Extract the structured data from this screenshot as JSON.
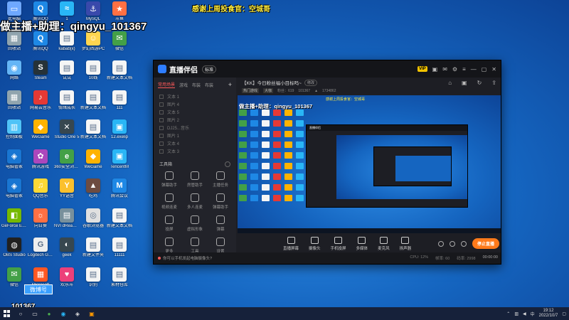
{
  "overlays": {
    "streamer_caption": "做主播+助理：qingyu_101367",
    "thanks_caption": "感谢上周投食官：空城哥",
    "tile_label": "微博号",
    "id_label": "101367"
  },
  "desktop_icons": [
    {
      "label": "此电脑",
      "color": "#6ea8ff",
      "glyph": "▭"
    },
    {
      "label": "腾讯QQ",
      "color": "#1e88e5",
      "glyph": "Q"
    },
    {
      "label": "1",
      "color": "#29b6f6",
      "glyph": "≈"
    },
    {
      "label": "MySQL",
      "color": "#3949ab",
      "glyph": "⚓"
    },
    {
      "label": "斗鱼",
      "color": "#ff7043",
      "glyph": "★"
    },
    {
      "label": "回收站",
      "color": "#90a4ae",
      "glyph": "▦"
    },
    {
      "label": "腾讯QQ",
      "color": "#1e88e5",
      "glyph": "Q"
    },
    {
      "label": "kabab(x)",
      "color": "#f5f5f5",
      "glyph": "▤"
    },
    {
      "label": "梦幻西游PC",
      "color": "#ffd54f",
      "glyph": "☺"
    },
    {
      "label": "微信",
      "color": "#43a047",
      "glyph": "✉"
    },
    {
      "label": "网络",
      "color": "#64b5f6",
      "glyph": "◉"
    },
    {
      "label": "Steam",
      "color": "#263238",
      "glyph": "S"
    },
    {
      "label": "试试",
      "color": "#f5f5f5",
      "glyph": "▤"
    },
    {
      "label": "10线",
      "color": "#f5f5f5",
      "glyph": "▤"
    },
    {
      "label": "新建文本文档",
      "color": "#f5f5f5",
      "glyph": "▤"
    },
    {
      "label": "回收站",
      "color": "#90a4ae",
      "glyph": "▦"
    },
    {
      "label": "网易云音乐",
      "color": "#e53935",
      "glyph": "♪"
    },
    {
      "label": "情绪成长",
      "color": "#f5f5f5",
      "glyph": "▤"
    },
    {
      "label": "新建文本文档",
      "color": "#f5f5f5",
      "glyph": "▤"
    },
    {
      "label": "111",
      "color": "#f5f5f5",
      "glyph": "▤"
    },
    {
      "label": "控制面板",
      "color": "#4fc3f7",
      "glyph": "▥"
    },
    {
      "label": "WeGame",
      "color": "#ffb300",
      "glyph": "◆"
    },
    {
      "label": "Studio One 5",
      "color": "#37474f",
      "glyph": "✕"
    },
    {
      "label": "新建文本文档",
      "color": "#f5f5f5",
      "glyph": "▤"
    },
    {
      "label": "12.exelip",
      "color": "#29b6f6",
      "glyph": "▣"
    },
    {
      "label": "电脑管家",
      "color": "#1976d2",
      "glyph": "◈"
    },
    {
      "label": "腾讯游戏",
      "color": "#ab47bc",
      "glyph": "✿"
    },
    {
      "label": "360安全浏览器",
      "color": "#43a047",
      "glyph": "e"
    },
    {
      "label": "WeGame",
      "color": "#ffb300",
      "glyph": "◆"
    },
    {
      "label": "TencentM",
      "color": "#29b6f6",
      "glyph": "▣"
    },
    {
      "label": "电脑管家",
      "color": "#1976d2",
      "glyph": "◈"
    },
    {
      "label": "QQ音乐",
      "color": "#fdd835",
      "glyph": "♫"
    },
    {
      "label": "YY语音",
      "color": "#fbc02d",
      "glyph": "Y"
    },
    {
      "label": "吃鸡",
      "color": "#6d4c41",
      "glyph": "▲"
    },
    {
      "label": "腾讯会议",
      "color": "#1e88e5",
      "glyph": "M"
    },
    {
      "label": "GeForce Experience",
      "color": "#76b900",
      "glyph": "◧"
    },
    {
      "label": "向日葵",
      "color": "#ff7043",
      "glyph": "☼"
    },
    {
      "label": "NVI dReamer",
      "color": "#78909c",
      "glyph": "▤"
    },
    {
      "label": "谷歌浏览器",
      "color": "#e0e0e0",
      "glyph": "◎"
    },
    {
      "label": "新建文本文档",
      "color": "#f5f5f5",
      "glyph": "▤"
    },
    {
      "label": "OBS Studio",
      "color": "#212121",
      "glyph": "◍"
    },
    {
      "label": "Logitech G HUB",
      "color": "#eeeeee",
      "glyph": "G"
    },
    {
      "label": "geek",
      "color": "#37474f",
      "glyph": "◐"
    },
    {
      "label": "新建文件夹",
      "color": "#f5f5f5",
      "glyph": "▤"
    },
    {
      "label": "11111",
      "color": "#f5f5f5",
      "glyph": "▤"
    },
    {
      "label": "微信",
      "color": "#43a047",
      "glyph": "✉"
    },
    {
      "label": "Microsoft",
      "color": "#ff5722",
      "glyph": "▦"
    },
    {
      "label": "欢乐斗",
      "color": "#ec407a",
      "glyph": "♥"
    },
    {
      "label": "识别",
      "color": "#f5f5f5",
      "glyph": "▤"
    },
    {
      "label": "素材仓库",
      "color": "#f5f5f5",
      "glyph": "▤"
    }
  ],
  "app": {
    "name": "直播伴侣",
    "version": "标准",
    "vip": "VIP",
    "tabs": [
      "常用场景",
      "游戏",
      "布装",
      "布装"
    ],
    "scenes": [
      "文本 1",
      "图片 4",
      "文本 5",
      "图片 2",
      "DJ25...音乐",
      "图片 1",
      "文本 4",
      "文本 3"
    ],
    "toolbox_label": "工具箱",
    "tools": [
      {
        "label": "弹幕助手"
      },
      {
        "label": "房管助手"
      },
      {
        "label": "主播任务"
      },
      {
        "label": "视频连麦"
      },
      {
        "label": "多人连麦"
      },
      {
        "label": "弹幕助手"
      },
      {
        "label": "投屏"
      },
      {
        "label": "虚拟形象"
      },
      {
        "label": "弹幕"
      },
      {
        "label": "更多"
      },
      {
        "label": "工具"
      },
      {
        "label": "设置"
      }
    ],
    "room_title": "【KK】今日粉丝福小目标吗~",
    "edit_label": "修改",
    "subbar": {
      "chip1": "热门游戏",
      "chip2": "大咖",
      "fans": "粉丝：619",
      "room_id": "101367",
      "hot": "1734862"
    },
    "preview_overlay": "做主播+助理：qingyu_101367",
    "preview_thanks": "感谢上周投食官：空城哥",
    "controls": [
      {
        "label": "直播屏幕"
      },
      {
        "label": "摄像头"
      },
      {
        "label": "手机投屏"
      },
      {
        "label": "多媒体"
      },
      {
        "label": "麦克风"
      },
      {
        "label": "扬声器"
      }
    ],
    "live_button": "停止直播",
    "status": {
      "hint": "你可以手机发起电脑摄像头?",
      "cpu": "CPU: 12%",
      "fps": "帧率: 60",
      "bitrate": "码率: 2998",
      "timer": "00:00:00"
    }
  },
  "taskbar": {
    "time": "19:12",
    "date": "2022/10/7"
  }
}
